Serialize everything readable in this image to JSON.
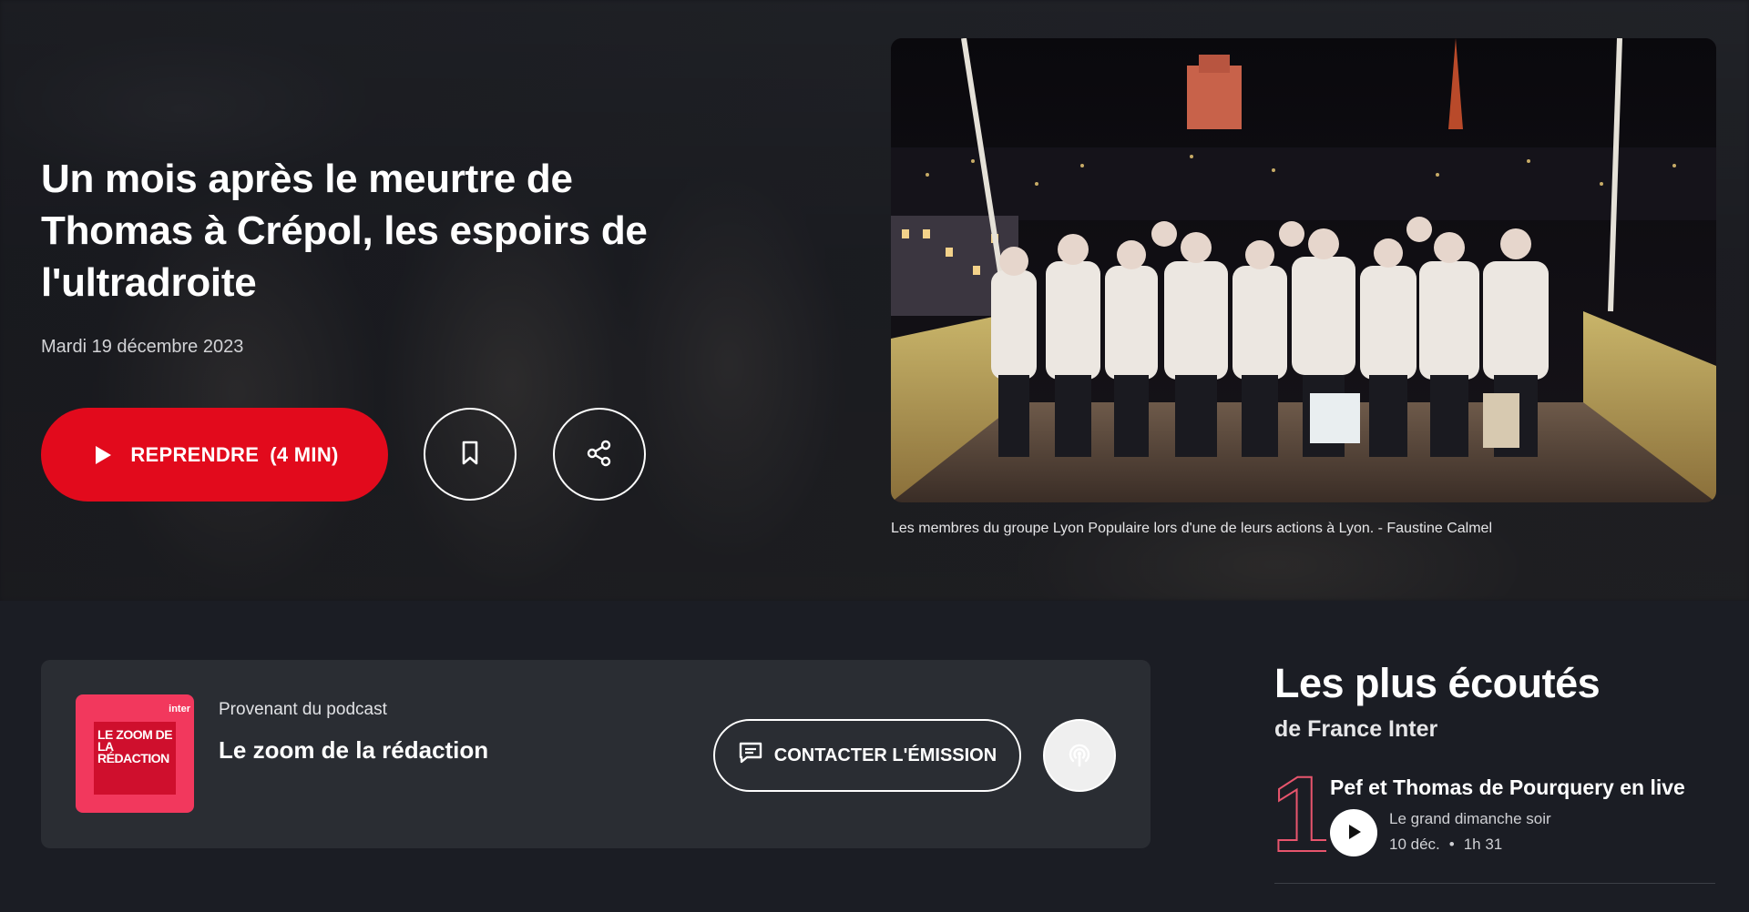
{
  "hero": {
    "title": "Un mois après le meurtre de Thomas à Crépol, les espoirs de l'ultradroite",
    "date": "Mardi 19 décembre 2023",
    "resume_label": "REPRENDRE",
    "resume_duration": "(4 MIN)",
    "photo_caption": "Les membres du groupe Lyon Populaire lors d'une de leurs actions à Lyon. - Faustine Calmel"
  },
  "podcast": {
    "from_label": "Provenant du podcast",
    "title": "Le zoom de la rédaction",
    "cover_text": "LE ZOOM DE LA RÉDACTION",
    "cover_brand": "inter",
    "contact_label": "CONTACTER L'ÉMISSION"
  },
  "most_listened": {
    "title": "Les plus écoutés",
    "subtitle": "de France Inter",
    "items": [
      {
        "rank": "1",
        "title": "Pef et Thomas de Pourquery en live",
        "show": "Le grand dimanche soir",
        "date": "10 déc.",
        "separator": "•",
        "duration": "1h 31"
      }
    ]
  },
  "colors": {
    "accent_red": "#e20a1c",
    "cover_pink": "#f2385d",
    "card_bg": "#2a2d33",
    "page_bg": "#1b1d24"
  },
  "icons": [
    "play-icon",
    "bookmark-icon",
    "share-icon",
    "message-icon",
    "podcast-icon"
  ]
}
